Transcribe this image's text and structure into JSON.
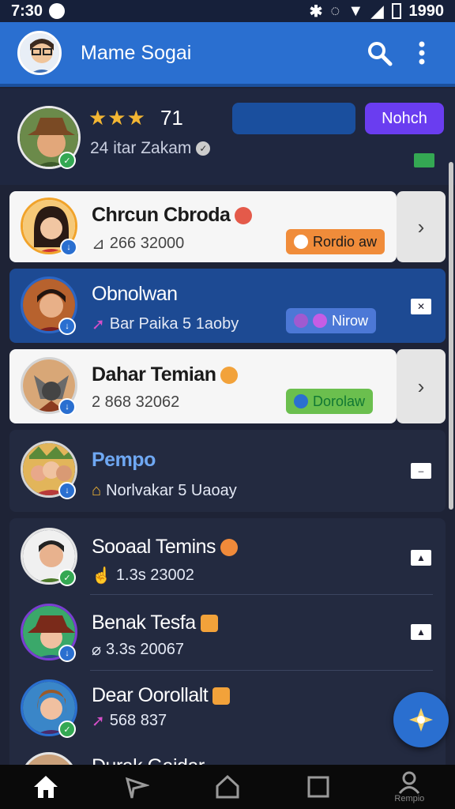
{
  "status": {
    "time": "7:30",
    "right_text": "1990"
  },
  "appbar": {
    "title": "Mame Sogai"
  },
  "profile": {
    "rating_value": "71",
    "stars": "★★★",
    "subtitle": "24 itar Zakam",
    "button_label": "Nohch"
  },
  "cards": [
    {
      "name": "Chrcun Cbroda",
      "meta": "266 32000",
      "chip": "Rordio aw",
      "chip_color": "#f08c3a",
      "style": "light"
    },
    {
      "name": "Obnolwan",
      "meta": "Bar Paika 5 1aoby",
      "chip": "Nirow",
      "chip_color": "#4c78d6",
      "style": "blue"
    },
    {
      "name": "Dahar Temian",
      "meta": "2 868 32062",
      "chip": "Dorolaw",
      "chip_color": "#6bbf4e",
      "style": "light"
    },
    {
      "name": "Pempo",
      "meta": "Norlvakar 5 Uaoay",
      "style": "dark"
    }
  ],
  "list": [
    {
      "name": "Sooaal Temins",
      "meta": "1.3s 23002"
    },
    {
      "name": "Benak Tesfa",
      "meta": "3.3s 20067"
    },
    {
      "name": "Dear Oorollalt",
      "meta": "568 837"
    },
    {
      "name": "Durak Gaidar"
    }
  ],
  "nav": {
    "profile_label": "Rempio"
  },
  "colors": {
    "primary": "#2a6fd0",
    "background": "#1e2336",
    "accent": "#6a3df0"
  },
  "icons": [
    "home-icon",
    "send-icon",
    "overview-icon",
    "square-icon",
    "profile-icon",
    "search-icon",
    "more-icon"
  ]
}
